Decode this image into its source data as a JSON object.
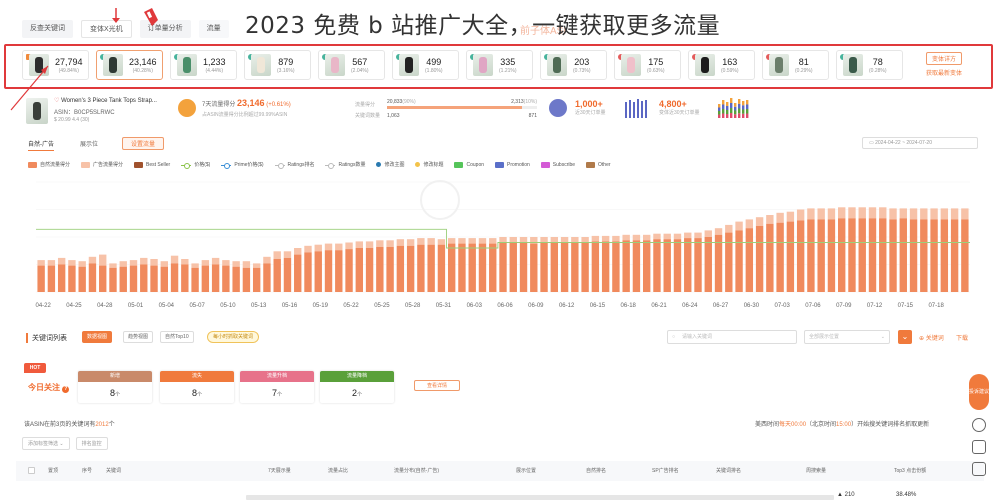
{
  "overlay_title": "2023 免费 b 站推广大全，一键获取更多流量",
  "ghost_text": "前子体ASI",
  "top_tabs": [
    "反查关键词",
    "变体X光机",
    "订单量分析",
    "流量"
  ],
  "variants": [
    {
      "num": "27,794",
      "pct": "(49.84%)",
      "dot": "o",
      "shirt": "#2d2d2d"
    },
    {
      "num": "23,146",
      "pct": "(40.28%)",
      "dot": "g",
      "shirt": "#2f3a34",
      "selected": true
    },
    {
      "num": "1,233",
      "pct": "(4.44%)",
      "dot": "g",
      "shirt": "#4a8f6a"
    },
    {
      "num": "879",
      "pct": "(3.16%)",
      "dot": "g",
      "shirt": "#f0e7d8"
    },
    {
      "num": "567",
      "pct": "(2.04%)",
      "dot": "g",
      "shirt": "#e9b7c8"
    },
    {
      "num": "499",
      "pct": "(1.80%)",
      "dot": "g",
      "shirt": "#222"
    },
    {
      "num": "335",
      "pct": "(1.21%)",
      "dot": "g",
      "shirt": "#e0a6c4"
    },
    {
      "num": "203",
      "pct": "(0.73%)",
      "dot": "g",
      "shirt": "#4f6b55"
    },
    {
      "num": "175",
      "pct": "(0.63%)",
      "dot": "r",
      "shirt": "#f0c0ca"
    },
    {
      "num": "163",
      "pct": "(0.59%)",
      "dot": "r",
      "shirt": "#1c1c1c"
    },
    {
      "num": "81",
      "pct": "(0.29%)",
      "dot": "r",
      "shirt": "#6b7e6b"
    },
    {
      "num": "78",
      "pct": "(0.28%)",
      "dot": "g",
      "shirt": "#3a5a4a"
    }
  ],
  "variant_side": {
    "button": "变体详方",
    "link": "获取最新变体"
  },
  "product": {
    "title": "Women's 3 Piece Tank Tops Strap...",
    "asin_label": "ASIN：",
    "asin": "B0CP5SLRWC",
    "price": "$ 20.99  4.4 (30)"
  },
  "metric_traffic": {
    "label": "7天流量得分",
    "value": "23,146",
    "change": "(+0.61%)",
    "sub": "占ASIN流量得分比例超过99.99%ASIN"
  },
  "metric_bars": {
    "label1": "流量得分",
    "v1": "20,833",
    "p1": "(90%)",
    "v1r": "2,313",
    "p1r": "(10%)",
    "label2": "关键词数量",
    "v2": "1,063",
    "v2r": "871"
  },
  "metric_orders": {
    "value": "1,000+",
    "sub": "近30天订单量"
  },
  "metric_sales": {
    "value": "4,800+",
    "sub": "变体近30天订单量"
  },
  "section": {
    "tab1": "自然-广告",
    "tab2": "展示位",
    "button": "设置流量",
    "date_range": "2024-04-22  ~  2024-07-20"
  },
  "legend": [
    {
      "label": "自然流量得分",
      "color": "#f08a5d",
      "type": "sw"
    },
    {
      "label": "广告流量得分",
      "color": "#f7c2a8",
      "type": "sw"
    },
    {
      "label": "Best Seller",
      "color": "#a0522d",
      "type": "sw"
    },
    {
      "label": "价格($)",
      "color": "#8bc34a",
      "type": "line"
    },
    {
      "label": "Prime价格($)",
      "color": "#3a8fd6",
      "type": "line"
    },
    {
      "label": "Ratings排名",
      "color": "#bbb",
      "type": "line"
    },
    {
      "label": "Ratings数量",
      "color": "#bbb",
      "type": "line"
    },
    {
      "label": "修改主图",
      "color": "#2a7ab0",
      "type": "dot"
    },
    {
      "label": "修改标题",
      "color": "#f3c34a",
      "type": "dot"
    },
    {
      "label": "Coupon",
      "color": "#55c45a",
      "type": "sw"
    },
    {
      "label": "Promotion",
      "color": "#5a6fc9",
      "type": "sw"
    },
    {
      "label": "Subscribe",
      "color": "#d45bd6",
      "type": "sw"
    },
    {
      "label": "Other",
      "color": "#b07a4a",
      "type": "sw"
    }
  ],
  "chart_data": {
    "type": "bar",
    "x_tick_labels": [
      "04-22",
      "04-25",
      "04-28",
      "05-01",
      "05-04",
      "05-07",
      "05-10",
      "05-13",
      "05-16",
      "05-19",
      "05-22",
      "05-25",
      "05-28",
      "05-31",
      "06-03",
      "06-06",
      "06-09",
      "06-12",
      "06-15",
      "06-18",
      "06-21",
      "06-24",
      "06-27",
      "06-30",
      "07-03",
      "07-06",
      "07-09",
      "07-12",
      "07-15",
      "07-18"
    ],
    "series": [
      {
        "name": "自然流量得分",
        "color": "#f08a5d",
        "values": [
          0.24,
          0.24,
          0.25,
          0.24,
          0.23,
          0.26,
          0.24,
          0.22,
          0.23,
          0.24,
          0.25,
          0.24,
          0.23,
          0.26,
          0.25,
          0.22,
          0.24,
          0.25,
          0.24,
          0.23,
          0.22,
          0.22,
          0.26,
          0.3,
          0.31,
          0.34,
          0.36,
          0.37,
          0.38,
          0.38,
          0.39,
          0.4,
          0.4,
          0.41,
          0.41,
          0.42,
          0.42,
          0.43,
          0.43,
          0.43,
          0.44,
          0.44,
          0.44,
          0.44,
          0.44,
          0.45,
          0.45,
          0.45,
          0.44,
          0.45,
          0.45,
          0.45,
          0.45,
          0.45,
          0.46,
          0.46,
          0.46,
          0.47,
          0.47,
          0.47,
          0.48,
          0.48,
          0.48,
          0.49,
          0.49,
          0.5,
          0.52,
          0.54,
          0.56,
          0.58,
          0.6,
          0.62,
          0.63,
          0.64,
          0.65,
          0.66,
          0.66,
          0.66,
          0.67,
          0.67,
          0.67,
          0.67,
          0.67,
          0.66,
          0.67,
          0.66,
          0.66,
          0.66,
          0.66,
          0.66,
          0.66
        ]
      },
      {
        "name": "广告流量得分",
        "color": "#f7c2a8",
        "values": [
          0.05,
          0.05,
          0.06,
          0.05,
          0.05,
          0.06,
          0.1,
          0.04,
          0.05,
          0.05,
          0.06,
          0.06,
          0.05,
          0.07,
          0.05,
          0.04,
          0.05,
          0.06,
          0.05,
          0.05,
          0.06,
          0.04,
          0.06,
          0.07,
          0.06,
          0.06,
          0.06,
          0.06,
          0.06,
          0.06,
          0.06,
          0.06,
          0.06,
          0.06,
          0.06,
          0.06,
          0.06,
          0.06,
          0.06,
          0.05,
          0.05,
          0.05,
          0.05,
          0.05,
          0.05,
          0.05,
          0.05,
          0.05,
          0.06,
          0.05,
          0.05,
          0.05,
          0.05,
          0.05,
          0.05,
          0.05,
          0.05,
          0.05,
          0.05,
          0.05,
          0.05,
          0.05,
          0.05,
          0.05,
          0.05,
          0.06,
          0.06,
          0.07,
          0.08,
          0.08,
          0.08,
          0.08,
          0.09,
          0.09,
          0.1,
          0.1,
          0.1,
          0.1,
          0.1,
          0.1,
          0.1,
          0.1,
          0.1,
          0.1,
          0.09,
          0.1,
          0.1,
          0.1,
          0.1,
          0.1,
          0.1
        ]
      },
      {
        "name": "价格($)",
        "color": "#9bcf7a",
        "values": [
          0.57,
          0.57,
          0.57,
          0.57,
          0.57,
          0.57,
          0.57,
          0.57,
          0.57,
          0.57,
          0.57,
          0.57,
          0.57,
          0.57,
          0.57,
          0.57,
          0.57,
          0.57,
          0.57,
          0.57,
          0.57,
          0.57,
          0.57,
          0.57,
          0.57,
          0.57,
          0.57,
          0.57,
          0.57,
          0.57,
          0.57,
          0.57,
          0.57,
          0.57,
          0.57,
          0.57,
          0.57,
          0.57,
          0.57,
          0.57,
          0.4,
          0.4,
          0.4,
          0.4,
          0.4,
          0.45,
          0.45,
          0.45,
          0.45,
          0.45,
          0.45,
          0.45,
          0.45,
          0.45,
          0.45,
          0.45,
          0.45,
          0.45,
          0.45,
          0.45,
          0.45,
          0.45,
          0.45,
          0.45,
          0.45,
          0.45,
          0.45,
          0.45,
          0.45,
          0.45,
          0.45,
          0.45,
          0.45,
          0.45,
          0.45,
          0.45,
          0.45,
          0.45,
          0.45,
          0.45,
          0.45,
          0.45,
          0.45,
          0.45,
          0.45,
          0.45,
          0.45,
          0.45,
          0.45,
          0.45,
          0.45
        ]
      }
    ]
  },
  "keywords": {
    "title": "关键词列表",
    "tabs": [
      "数据视图",
      "趋势视图",
      "自然Top10"
    ],
    "yellow_btn": "每小时抓取关键词",
    "search_placeholder": "请输入关键词",
    "select_placeholder": "全部展示位置",
    "right1": "⊕ 关键词",
    "right2": "下载"
  },
  "today": {
    "hot": "HOT",
    "label": "今日关注",
    "cards": [
      {
        "title": "新增",
        "value": "8",
        "unit": "个",
        "color": "#c98a6a"
      },
      {
        "title": "流失",
        "value": "8",
        "unit": "个",
        "color": "#f07a3c"
      },
      {
        "title": "流量升档",
        "value": "7",
        "unit": "个",
        "color": "#e7728a"
      },
      {
        "title": "流量降档",
        "value": "2",
        "unit": "个",
        "color": "#5aa03a"
      }
    ],
    "detail_btn": "查看详情"
  },
  "info": {
    "left_pre": "该ASIN在前3页的关键词有",
    "left_num": "2012",
    "left_post": "个",
    "right_pre": "美西时间",
    "right_time1": "每天00:00",
    "right_mid": "（北京时间",
    "right_time2": "15:00",
    "right_post": "）开始搜关键词排名抓取更新"
  },
  "filters": [
    "添加标签筛选",
    "排名监控"
  ],
  "table_headers": [
    "置顶",
    "序号",
    "关键词",
    "7天展示量",
    "流量占比",
    "流量分布(自然-广告)",
    "展示位置",
    "自然排名",
    "SP广告排名",
    "关键词排名",
    "周搜索量",
    "Top3 点击份额"
  ],
  "row1": {
    "search": "210",
    "click": "38.48%"
  },
  "dock": {
    "main": "投诉建议"
  }
}
